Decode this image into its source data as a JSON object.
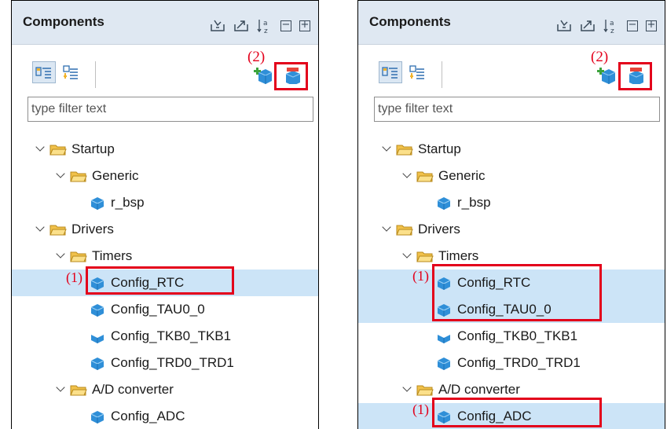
{
  "panels": [
    {
      "title": "Components",
      "filter_placeholder": "type filter text",
      "annotation_remove": "(2)",
      "annotation_select": "(1)",
      "tree": [
        {
          "label": "Startup",
          "level": 0,
          "kind": "folder"
        },
        {
          "label": "Generic",
          "level": 1,
          "kind": "folder"
        },
        {
          "label": "r_bsp",
          "level": 2,
          "kind": "component"
        },
        {
          "label": "Drivers",
          "level": 0,
          "kind": "folder"
        },
        {
          "label": "Timers",
          "level": 1,
          "kind": "folder"
        },
        {
          "label": "Config_RTC",
          "level": 2,
          "kind": "component",
          "selected": true
        },
        {
          "label": "Config_TAU0_0",
          "level": 2,
          "kind": "component"
        },
        {
          "label": "Config_TKB0_TKB1",
          "level": 2,
          "kind": "component-flat"
        },
        {
          "label": "Config_TRD0_TRD1",
          "level": 2,
          "kind": "component"
        },
        {
          "label": "A/D converter",
          "level": 1,
          "kind": "folder"
        },
        {
          "label": "Config_ADC",
          "level": 2,
          "kind": "component"
        }
      ]
    },
    {
      "title": "Components",
      "filter_placeholder": "type filter text",
      "annotation_remove": "(2)",
      "annotation_select": "(1)",
      "tree": [
        {
          "label": "Startup",
          "level": 0,
          "kind": "folder"
        },
        {
          "label": "Generic",
          "level": 1,
          "kind": "folder"
        },
        {
          "label": "r_bsp",
          "level": 2,
          "kind": "component"
        },
        {
          "label": "Drivers",
          "level": 0,
          "kind": "folder"
        },
        {
          "label": "Timers",
          "level": 1,
          "kind": "folder"
        },
        {
          "label": "Config_RTC",
          "level": 2,
          "kind": "component",
          "selected": true
        },
        {
          "label": "Config_TAU0_0",
          "level": 2,
          "kind": "component",
          "selected": true
        },
        {
          "label": "Config_TKB0_TKB1",
          "level": 2,
          "kind": "component-flat"
        },
        {
          "label": "Config_TRD0_TRD1",
          "level": 2,
          "kind": "component"
        },
        {
          "label": "A/D converter",
          "level": 1,
          "kind": "folder"
        },
        {
          "label": "Config_ADC",
          "level": 2,
          "kind": "component",
          "selected": true
        }
      ]
    }
  ],
  "icons": {
    "header": [
      "import-icon",
      "export-icon",
      "sort-az-icon",
      "collapse-all-icon",
      "expand-all-icon"
    ],
    "toolbar": [
      "component-view-icon",
      "hardware-view-icon",
      "add-component-icon",
      "remove-component-icon"
    ]
  },
  "colors": {
    "header_bg": "#dfe8f2",
    "selection": "#cce4f7",
    "highlight": "#e3001b",
    "folder": "#f1c14a",
    "cube": "#2f8fd8"
  }
}
